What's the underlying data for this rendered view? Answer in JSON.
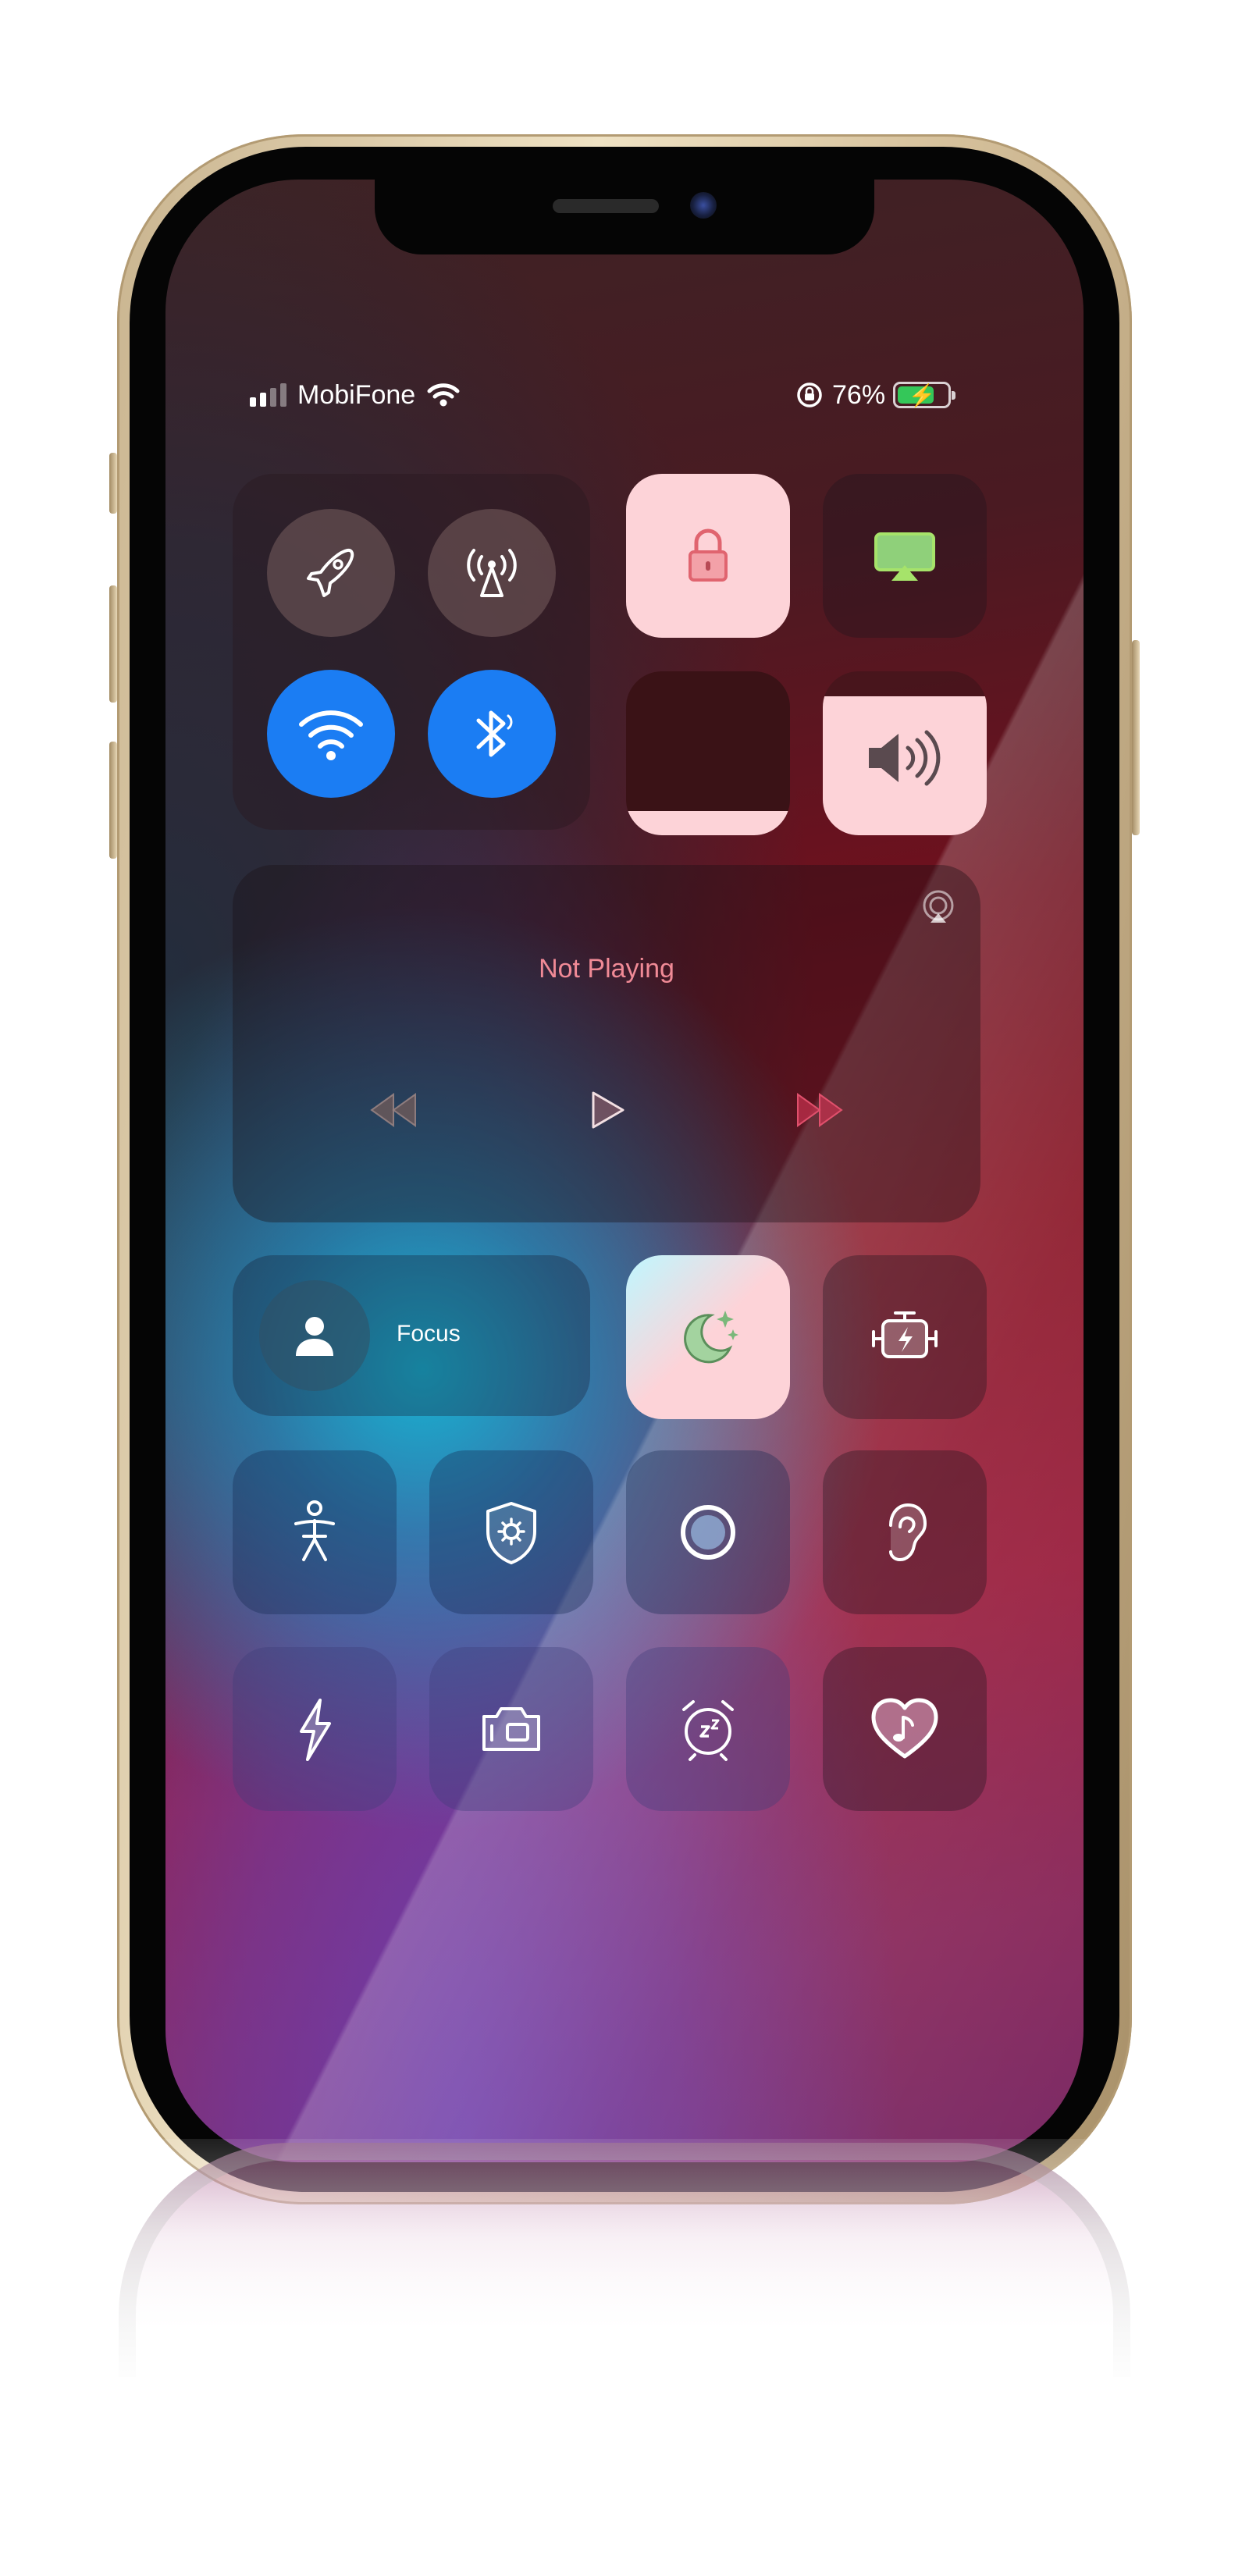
{
  "status_bar": {
    "carrier": "MobiFone",
    "battery_percent": "76%",
    "battery_level": 0.76,
    "signal_bars": 2
  },
  "connectivity": {
    "airplane_mode": "off",
    "cellular_data": "off",
    "wifi": "on",
    "bluetooth": "on"
  },
  "media": {
    "now_playing": "Not Playing"
  },
  "brightness_level": 0.15,
  "volume_level": 0.85,
  "focus": {
    "label": "Focus"
  },
  "colors": {
    "accent_blue": "#1b7df3",
    "toggle_light": "#fdd3d8",
    "media_text": "#f08a96",
    "battery_green": "#34c759"
  },
  "icons": [
    "airplane-icon",
    "cellular-antenna-icon",
    "wifi-icon",
    "bluetooth-icon",
    "rotation-lock-icon",
    "screen-mirroring-icon",
    "volume-icon",
    "airplay-icon",
    "rewind-icon",
    "play-icon",
    "fast-forward-icon",
    "person-icon",
    "dark-mode-moon-icon",
    "low-power-engine-icon",
    "accessibility-icon",
    "shield-gear-icon",
    "record-circle-icon",
    "hearing-ear-icon",
    "flashlight-bolt-icon",
    "camera-icon",
    "alarm-sleep-icon",
    "heart-music-icon"
  ]
}
